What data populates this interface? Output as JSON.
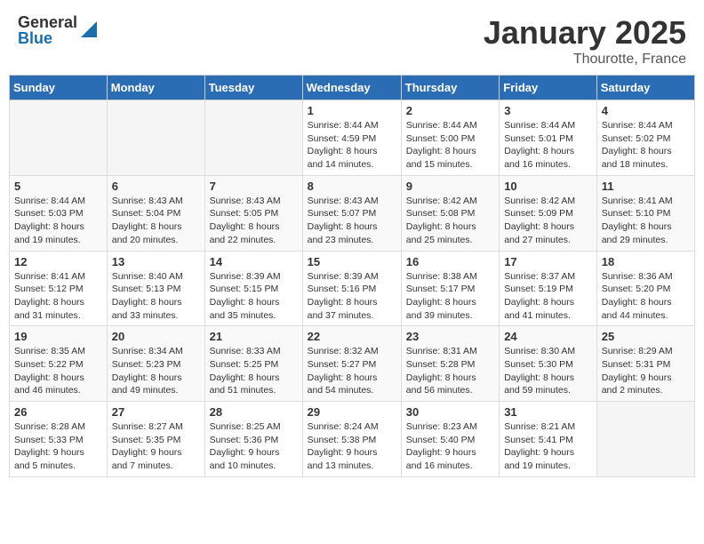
{
  "header": {
    "logo_general": "General",
    "logo_blue": "Blue",
    "month": "January 2025",
    "location": "Thourotte, France"
  },
  "weekdays": [
    "Sunday",
    "Monday",
    "Tuesday",
    "Wednesday",
    "Thursday",
    "Friday",
    "Saturday"
  ],
  "weeks": [
    [
      {
        "day": "",
        "info": ""
      },
      {
        "day": "",
        "info": ""
      },
      {
        "day": "",
        "info": ""
      },
      {
        "day": "1",
        "info": "Sunrise: 8:44 AM\nSunset: 4:59 PM\nDaylight: 8 hours\nand 14 minutes."
      },
      {
        "day": "2",
        "info": "Sunrise: 8:44 AM\nSunset: 5:00 PM\nDaylight: 8 hours\nand 15 minutes."
      },
      {
        "day": "3",
        "info": "Sunrise: 8:44 AM\nSunset: 5:01 PM\nDaylight: 8 hours\nand 16 minutes."
      },
      {
        "day": "4",
        "info": "Sunrise: 8:44 AM\nSunset: 5:02 PM\nDaylight: 8 hours\nand 18 minutes."
      }
    ],
    [
      {
        "day": "5",
        "info": "Sunrise: 8:44 AM\nSunset: 5:03 PM\nDaylight: 8 hours\nand 19 minutes."
      },
      {
        "day": "6",
        "info": "Sunrise: 8:43 AM\nSunset: 5:04 PM\nDaylight: 8 hours\nand 20 minutes."
      },
      {
        "day": "7",
        "info": "Sunrise: 8:43 AM\nSunset: 5:05 PM\nDaylight: 8 hours\nand 22 minutes."
      },
      {
        "day": "8",
        "info": "Sunrise: 8:43 AM\nSunset: 5:07 PM\nDaylight: 8 hours\nand 23 minutes."
      },
      {
        "day": "9",
        "info": "Sunrise: 8:42 AM\nSunset: 5:08 PM\nDaylight: 8 hours\nand 25 minutes."
      },
      {
        "day": "10",
        "info": "Sunrise: 8:42 AM\nSunset: 5:09 PM\nDaylight: 8 hours\nand 27 minutes."
      },
      {
        "day": "11",
        "info": "Sunrise: 8:41 AM\nSunset: 5:10 PM\nDaylight: 8 hours\nand 29 minutes."
      }
    ],
    [
      {
        "day": "12",
        "info": "Sunrise: 8:41 AM\nSunset: 5:12 PM\nDaylight: 8 hours\nand 31 minutes."
      },
      {
        "day": "13",
        "info": "Sunrise: 8:40 AM\nSunset: 5:13 PM\nDaylight: 8 hours\nand 33 minutes."
      },
      {
        "day": "14",
        "info": "Sunrise: 8:39 AM\nSunset: 5:15 PM\nDaylight: 8 hours\nand 35 minutes."
      },
      {
        "day": "15",
        "info": "Sunrise: 8:39 AM\nSunset: 5:16 PM\nDaylight: 8 hours\nand 37 minutes."
      },
      {
        "day": "16",
        "info": "Sunrise: 8:38 AM\nSunset: 5:17 PM\nDaylight: 8 hours\nand 39 minutes."
      },
      {
        "day": "17",
        "info": "Sunrise: 8:37 AM\nSunset: 5:19 PM\nDaylight: 8 hours\nand 41 minutes."
      },
      {
        "day": "18",
        "info": "Sunrise: 8:36 AM\nSunset: 5:20 PM\nDaylight: 8 hours\nand 44 minutes."
      }
    ],
    [
      {
        "day": "19",
        "info": "Sunrise: 8:35 AM\nSunset: 5:22 PM\nDaylight: 8 hours\nand 46 minutes."
      },
      {
        "day": "20",
        "info": "Sunrise: 8:34 AM\nSunset: 5:23 PM\nDaylight: 8 hours\nand 49 minutes."
      },
      {
        "day": "21",
        "info": "Sunrise: 8:33 AM\nSunset: 5:25 PM\nDaylight: 8 hours\nand 51 minutes."
      },
      {
        "day": "22",
        "info": "Sunrise: 8:32 AM\nSunset: 5:27 PM\nDaylight: 8 hours\nand 54 minutes."
      },
      {
        "day": "23",
        "info": "Sunrise: 8:31 AM\nSunset: 5:28 PM\nDaylight: 8 hours\nand 56 minutes."
      },
      {
        "day": "24",
        "info": "Sunrise: 8:30 AM\nSunset: 5:30 PM\nDaylight: 8 hours\nand 59 minutes."
      },
      {
        "day": "25",
        "info": "Sunrise: 8:29 AM\nSunset: 5:31 PM\nDaylight: 9 hours\nand 2 minutes."
      }
    ],
    [
      {
        "day": "26",
        "info": "Sunrise: 8:28 AM\nSunset: 5:33 PM\nDaylight: 9 hours\nand 5 minutes."
      },
      {
        "day": "27",
        "info": "Sunrise: 8:27 AM\nSunset: 5:35 PM\nDaylight: 9 hours\nand 7 minutes."
      },
      {
        "day": "28",
        "info": "Sunrise: 8:25 AM\nSunset: 5:36 PM\nDaylight: 9 hours\nand 10 minutes."
      },
      {
        "day": "29",
        "info": "Sunrise: 8:24 AM\nSunset: 5:38 PM\nDaylight: 9 hours\nand 13 minutes."
      },
      {
        "day": "30",
        "info": "Sunrise: 8:23 AM\nSunset: 5:40 PM\nDaylight: 9 hours\nand 16 minutes."
      },
      {
        "day": "31",
        "info": "Sunrise: 8:21 AM\nSunset: 5:41 PM\nDaylight: 9 hours\nand 19 minutes."
      },
      {
        "day": "",
        "info": ""
      }
    ]
  ]
}
